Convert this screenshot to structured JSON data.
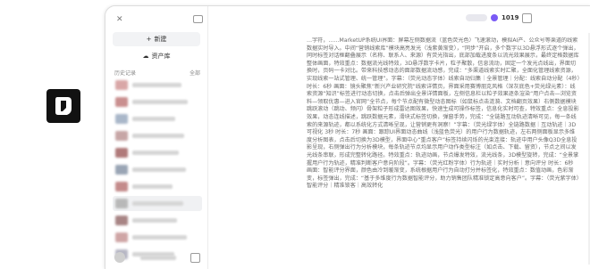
{
  "sidebar": {
    "new_label": "新建",
    "library_label": "资产库",
    "history_title": "历史记录",
    "history_action": "全部",
    "history": [
      {
        "thumb_color": "#d9a7a7"
      },
      {
        "thumb_color": "#c98f8f"
      },
      {
        "thumb_color": "#a9b7c9"
      },
      {
        "thumb_color": "#c7a6a6"
      },
      {
        "thumb_color": "#b07a7a"
      },
      {
        "thumb_color": "#9aa5b5"
      },
      {
        "thumb_color": "#c48b8b"
      },
      {
        "thumb_color": "#b8b8b8"
      },
      {
        "thumb_color": "#a88585"
      },
      {
        "thumb_color": "#cfa5a5"
      },
      {
        "thumb_color": "#b6b6c4"
      }
    ]
  },
  "topbar": {
    "coin_count": "1019"
  },
  "document": {
    "text": "…字符，……MarketUP系统UI界面：屏幕左侧数据流（蓝色荧光色）飞速滚动，模拟AI产、公众号等渠道的线索数据实时导入。中间“营销线索库”模块高亮发光（浅紫黄渐变），“同步”开启，多个数字以3D悬浮形式逐个弹出，同时标签对话框翻叠展示（名称、联系人、来源）有荧光指出，底部加载进度条以流光效果展示，最终定格数据库整体画面，特效重点：数据流光线特效，3D悬浮数字卡片，粒子聚散，信息流动，固定一个发光点线出，界面切换时，页码一卡对比。带来科技感动态的面部数据流动感，完成：“多渠道线索实时汇聚，全面化管理线索资源，实现线索一站式管理、统一管理”。字幕：（荧光动态字体）线索自动归集｜全景管理｜分配：线索自动分配（4秒）时长：6秒 画面：镜头聚焦“新兴产业研究院”线索详情页，界面采用赛博朋克风格（深灰底色+荧光绿元素）：线索资源“知识”标签进行动态切换，点击后弹出全景详情面板，左侧信息栏以粒子效果逐条渲染“用户点击—浏览资料—领取优惠—进入官网”全节点，每个节点配有微型动态图标（如鼠标点击涟漪、文档翻页效果）右侧数据模块跳跃滚动（跳动、频闪）骨架粒子形成雷达图效果，快速生成可操作标签，信息化实时可查，特效重点：全息投影效果，动态连线描述，跳跃数据元素，滑块式标签切换，弹窗手势，完成：“全链路互动轨迹清晰可见，每一条线索的来源轨迹，都以系统化方式清晰呈现，让营销更有洞察！”字幕：（荧光绿字体）全链路数据｜互动轨迹｜3D可视化 3秒 时长：7秒 画面：跟踪UI界面动态曲线（浅蓝色荧光）的用户行为数据轨迹，左右两侧面板显示多维度分析图表，点击后切换为3D模型，界面中心“重点客户”标签持续闪烁的光束连接：轨迹中用户头像Q3D全息投影呈现，右侧弹出行为分析模块，每条轨迹节点均显示用户动作类型标注（如点击、下载、留资），节点之间以发光线条串联，形成完整转化路径。特效重点：轨迹动画，节点爆发特效，流光线条，3D模型旋转，完成：“全景掌握用户行为轨迹，精准判断客户意向阶段”。字幕：（荧光红粉字体）行为轨迹｜实时分析｜意向评分 时长：6秒 画面：智能评分界面，颜色由冷到暖渐变，系统根据用户行为自动打分并标签化，特效重点：数值动画，色彩渐变，标签弹出，完成：“基于多维度行为数据智能评分，助力销售团队精准锁定高意向客户”。字幕：（荧光紫字体）智能评分｜精准锁客｜高效转化"
  }
}
